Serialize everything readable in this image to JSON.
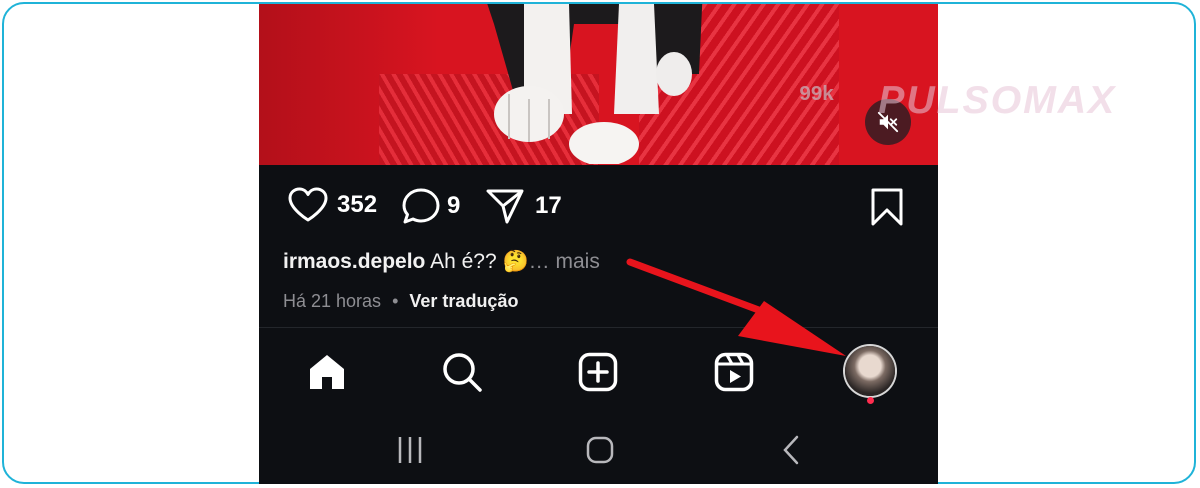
{
  "post": {
    "likes": "352",
    "comments": "9",
    "shares": "17",
    "username": "irmaos.depelo",
    "caption_text": "Ah é??",
    "caption_emoji": "🤔",
    "more_label": "… mais",
    "time_ago": "Há 21 horas",
    "separator": "•",
    "translate_label": "Ver tradução"
  },
  "watermark": {
    "text": "PULSOMAX",
    "badge": "99k"
  },
  "icons": {
    "like": "heart-icon",
    "comment": "comment-icon",
    "share": "send-icon",
    "save": "bookmark-icon",
    "mute": "muted-speaker-icon",
    "home": "home-icon",
    "search": "search-icon",
    "create": "plus-square-icon",
    "reels": "reels-icon",
    "profile": "avatar",
    "recents": "recents-icon",
    "system_home": "system-home-icon",
    "back": "back-icon"
  },
  "colors": {
    "background": "#0d0f13",
    "text": "#ffffff",
    "muted_text": "#8e8e93",
    "notification_dot": "#ff2d4f",
    "annotation_arrow": "#e8141c",
    "frame_border": "#1fb3d8"
  }
}
